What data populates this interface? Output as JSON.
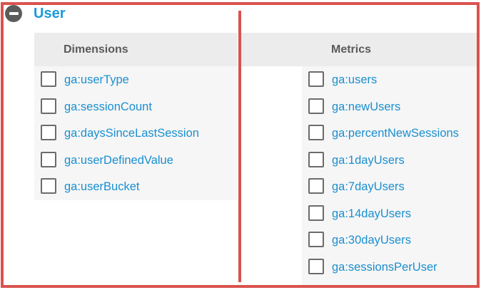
{
  "section": {
    "title": "User",
    "collapse_icon": "minus-circle-icon"
  },
  "dimensions": {
    "header": "Dimensions",
    "items": [
      {
        "label": "ga:userType"
      },
      {
        "label": "ga:sessionCount"
      },
      {
        "label": "ga:daysSinceLastSession"
      },
      {
        "label": "ga:userDefinedValue"
      },
      {
        "label": "ga:userBucket"
      }
    ]
  },
  "metrics": {
    "header": "Metrics",
    "items": [
      {
        "label": "ga:users"
      },
      {
        "label": "ga:newUsers"
      },
      {
        "label": "ga:percentNewSessions"
      },
      {
        "label": "ga:1dayUsers"
      },
      {
        "label": "ga:7dayUsers"
      },
      {
        "label": "ga:14dayUsers"
      },
      {
        "label": "ga:30dayUsers"
      },
      {
        "label": "ga:sessionsPerUser"
      }
    ]
  },
  "colors": {
    "accent": "#1a9ad8",
    "highlight_border": "#d9534f",
    "header_bg": "#ececec",
    "panel_bg": "#f6f6f6"
  }
}
